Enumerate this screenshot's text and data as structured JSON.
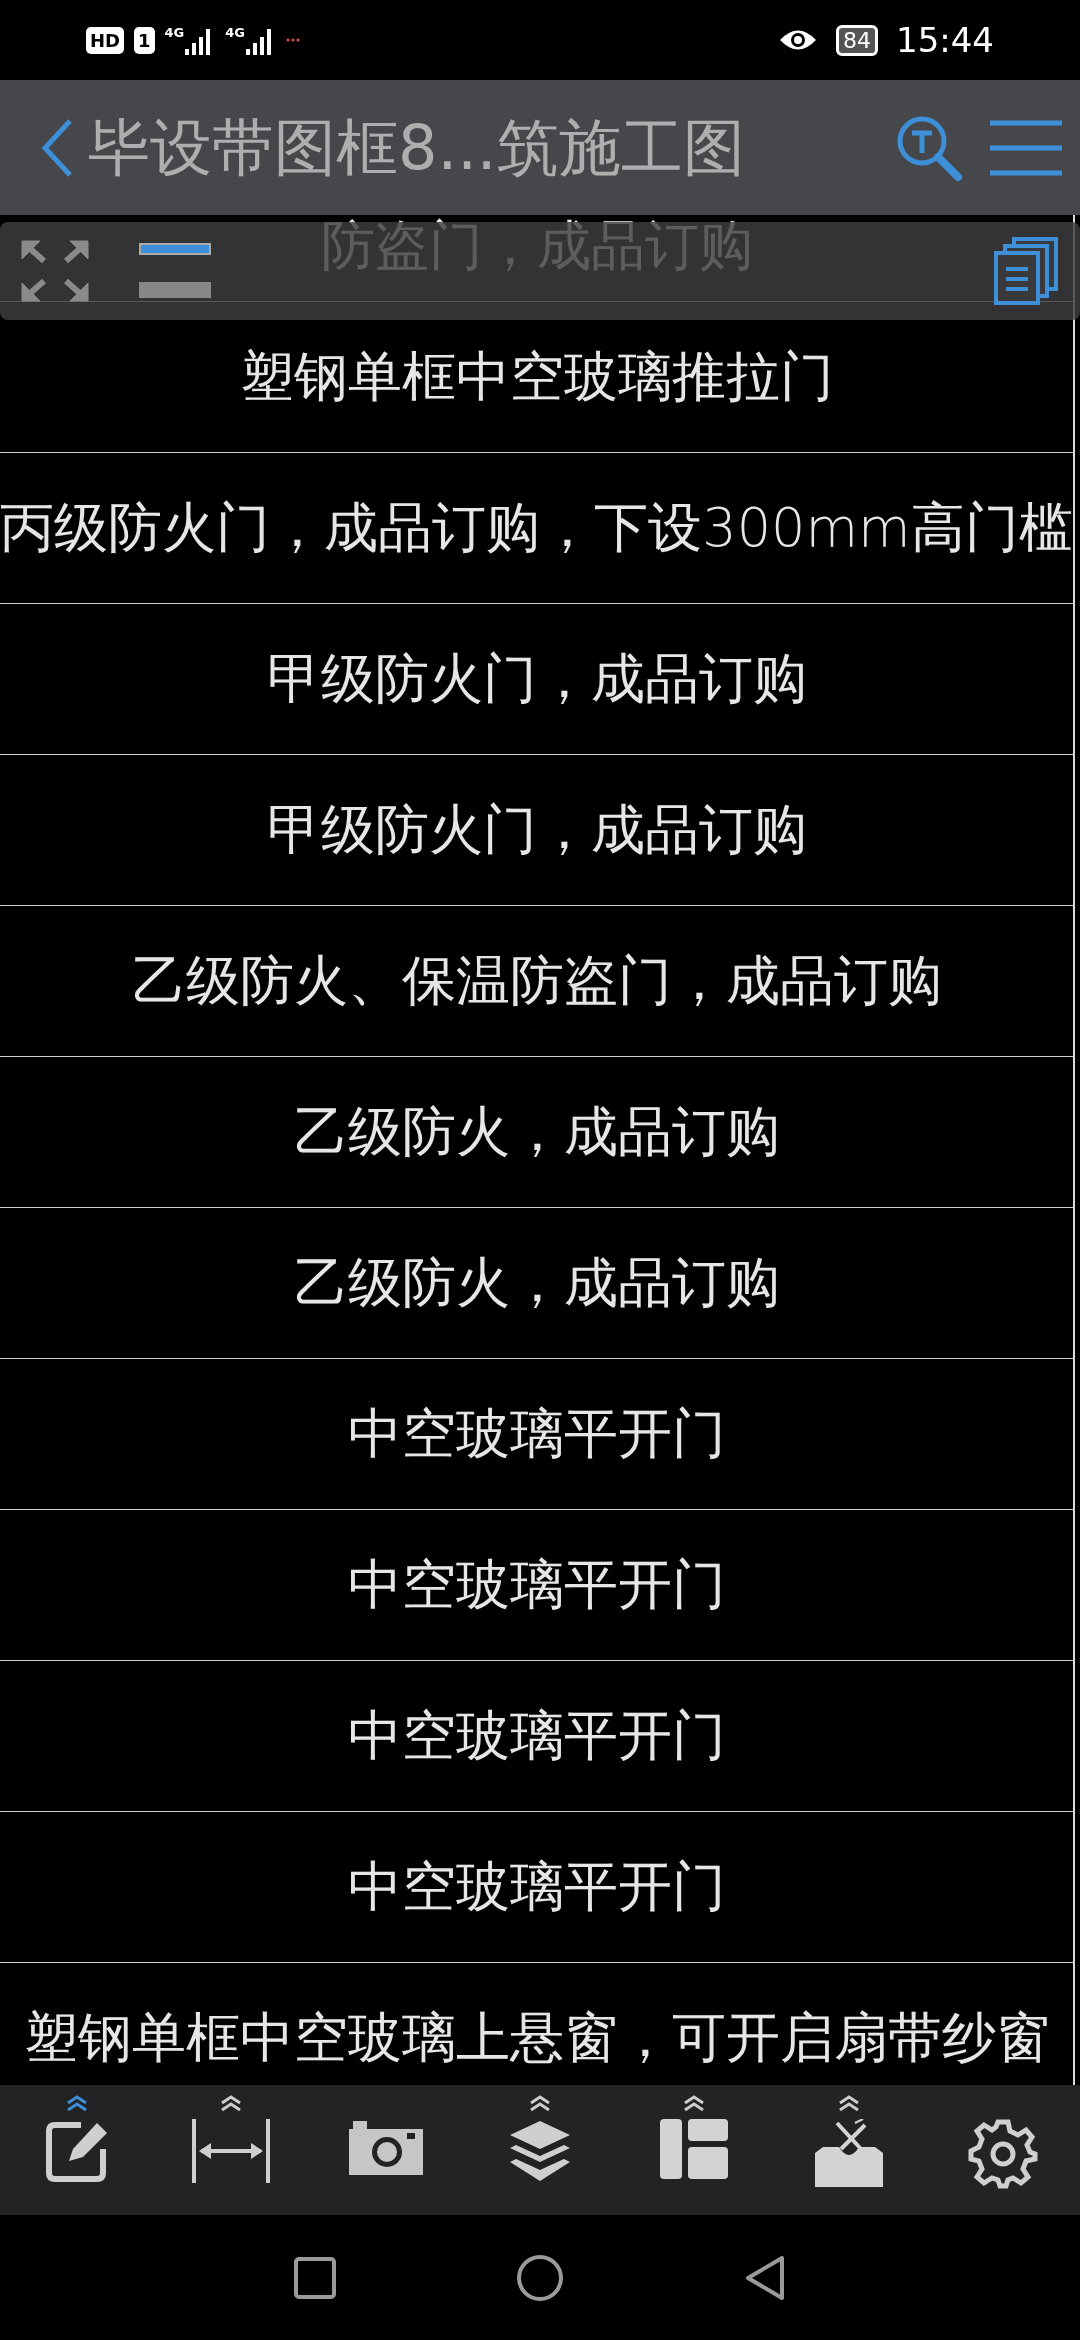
{
  "status_bar": {
    "hd": "HD",
    "sim": "1",
    "networks": [
      "4G",
      "4G"
    ],
    "battery": "84",
    "time": "15:44"
  },
  "header": {
    "title": "毕设带图框8...筑施工图"
  },
  "drawing": {
    "rows": [
      "防盗门，成品订购",
      "塑钢单框中空玻璃推拉门",
      "丙级防火门，成品订购，下设300mm高门槛",
      "甲级防火门，成品订购",
      "甲级防火门，成品订购",
      "乙级防火、保温防盗门，成品订购",
      "乙级防火，成品订购",
      "乙级防火，成品订购",
      "中空玻璃平开门",
      "中空玻璃平开门",
      "中空玻璃平开门",
      "中空玻璃平开门",
      "塑钢单框中空玻璃上悬窗，可开启扇带纱窗"
    ]
  },
  "tools": [
    {
      "kind": "edit",
      "has_menu": true,
      "selected": true
    },
    {
      "kind": "measure",
      "has_menu": true,
      "selected": false
    },
    {
      "kind": "camera",
      "has_menu": false,
      "selected": false
    },
    {
      "kind": "layers",
      "has_menu": true,
      "selected": false
    },
    {
      "kind": "layout",
      "has_menu": true,
      "selected": false
    },
    {
      "kind": "toolbox",
      "has_menu": true,
      "selected": false
    },
    {
      "kind": "settings",
      "has_menu": false,
      "selected": false
    }
  ]
}
